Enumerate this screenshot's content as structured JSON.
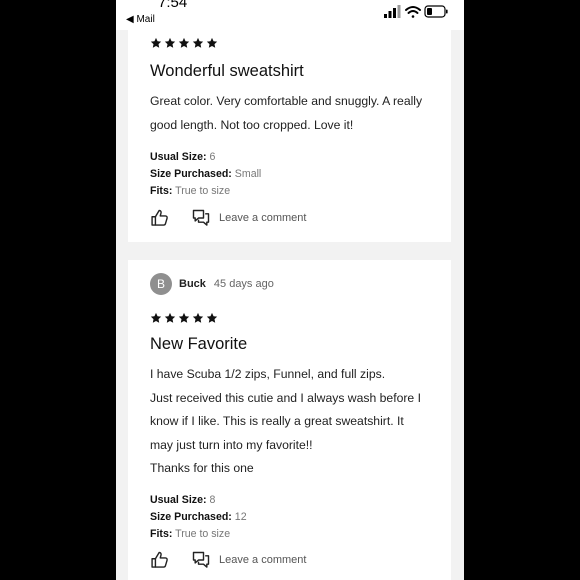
{
  "status_bar": {
    "time": "7:54",
    "back_label": "◀ Mail"
  },
  "reviews": [
    {
      "rating": 5,
      "title": "Wonderful sweatshirt",
      "body": [
        "Great color. Very comfortable and snuggly. A really",
        "good length. Not too cropped. Love it!"
      ],
      "usual_size_label": "Usual Size:",
      "usual_size": "6",
      "size_purchased_label": "Size Purchased:",
      "size_purchased": "Small",
      "fits_label": "Fits:",
      "fits": "True to size",
      "comment_label": "Leave a comment"
    },
    {
      "avatar_letter": "B",
      "reviewer": "Buck",
      "time_ago": "45 days ago",
      "rating": 5,
      "title": "New Favorite",
      "body": [
        "I have Scuba 1/2 zips, Funnel, and full zips.",
        "Just received this cutie and I always wash before I",
        "know if I like. This is really a great sweatshirt. It",
        "may just turn into my favorite!!",
        "Thanks for this one"
      ],
      "usual_size_label": "Usual Size:",
      "usual_size": "8",
      "size_purchased_label": "Size Purchased:",
      "size_purchased": "12",
      "fits_label": "Fits:",
      "fits": "True to size",
      "comment_label": "Leave a comment"
    }
  ],
  "icons": {
    "star": "star-icon",
    "thumbs_up": "thumbs-up-icon",
    "comment": "comment-icon"
  },
  "colors": {
    "background": "#000000",
    "page": "#f2f2f2",
    "card": "#ffffff",
    "avatar": "#8f8f8f",
    "muted": "#777777"
  }
}
